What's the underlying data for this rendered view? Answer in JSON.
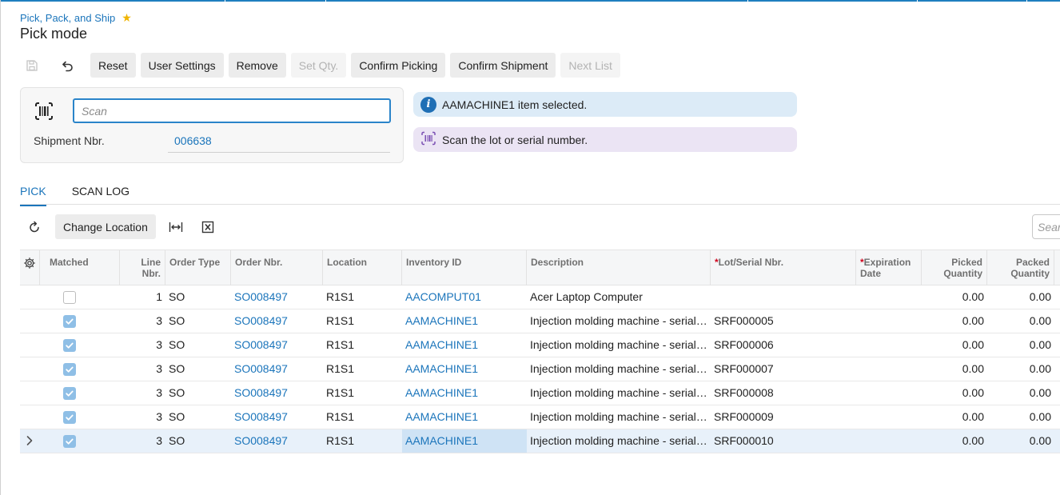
{
  "breadcrumb": "Pick, Pack, and Ship",
  "page_title": "Pick mode",
  "toolbar": {
    "save_icon": "save-icon",
    "undo_icon": "undo-icon",
    "reset": "Reset",
    "user_settings": "User Settings",
    "remove": "Remove",
    "set_qty": "Set Qty.",
    "confirm_picking": "Confirm Picking",
    "confirm_shipment": "Confirm Shipment",
    "next_list": "Next List"
  },
  "scan": {
    "placeholder": "Scan",
    "value": "",
    "shipment_label": "Shipment Nbr.",
    "shipment_value": "006638"
  },
  "messages": {
    "info": "AAMACHINE1 item selected.",
    "prompt": "Scan the lot or serial number."
  },
  "tabs": [
    "PICK",
    "SCAN LOG"
  ],
  "grid_toolbar": {
    "change_location": "Change Location",
    "search_placeholder": "Search"
  },
  "grid": {
    "headers": {
      "matched": "Matched",
      "line_nbr": "Line Nbr.",
      "order_type": "Order Type",
      "order_nbr": "Order Nbr.",
      "location": "Location",
      "inventory_id": "Inventory ID",
      "description": "Description",
      "lot_serial": "Lot/Serial Nbr.",
      "expiration_date": "Expiration Date",
      "picked_quantity": "Picked Quantity",
      "packed_quantity": "Packed Quantity"
    },
    "rows": [
      {
        "matched": false,
        "line_nbr": "1",
        "order_type": "SO",
        "order_nbr": "SO008497",
        "location": "R1S1",
        "inventory_id": "AACOMPUT01",
        "description": "Acer Laptop Computer",
        "lot_serial": "",
        "expiration_date": "",
        "picked": "0.00",
        "packed": "0.00"
      },
      {
        "matched": true,
        "line_nbr": "3",
        "order_type": "SO",
        "order_nbr": "SO008497",
        "location": "R1S1",
        "inventory_id": "AAMACHINE1",
        "description": "Injection molding machine - serial…",
        "lot_serial": "SRF000005",
        "expiration_date": "",
        "picked": "0.00",
        "packed": "0.00"
      },
      {
        "matched": true,
        "line_nbr": "3",
        "order_type": "SO",
        "order_nbr": "SO008497",
        "location": "R1S1",
        "inventory_id": "AAMACHINE1",
        "description": "Injection molding machine - serial…",
        "lot_serial": "SRF000006",
        "expiration_date": "",
        "picked": "0.00",
        "packed": "0.00"
      },
      {
        "matched": true,
        "line_nbr": "3",
        "order_type": "SO",
        "order_nbr": "SO008497",
        "location": "R1S1",
        "inventory_id": "AAMACHINE1",
        "description": "Injection molding machine - serial…",
        "lot_serial": "SRF000007",
        "expiration_date": "",
        "picked": "0.00",
        "packed": "0.00"
      },
      {
        "matched": true,
        "line_nbr": "3",
        "order_type": "SO",
        "order_nbr": "SO008497",
        "location": "R1S1",
        "inventory_id": "AAMACHINE1",
        "description": "Injection molding machine - serial…",
        "lot_serial": "SRF000008",
        "expiration_date": "",
        "picked": "0.00",
        "packed": "0.00"
      },
      {
        "matched": true,
        "line_nbr": "3",
        "order_type": "SO",
        "order_nbr": "SO008497",
        "location": "R1S1",
        "inventory_id": "AAMACHINE1",
        "description": "Injection molding machine - serial…",
        "lot_serial": "SRF000009",
        "expiration_date": "",
        "picked": "0.00",
        "packed": "0.00"
      },
      {
        "matched": true,
        "line_nbr": "3",
        "order_type": "SO",
        "order_nbr": "SO008497",
        "location": "R1S1",
        "inventory_id": "AAMACHINE1",
        "description": "Injection molding machine - serial…",
        "lot_serial": "SRF000010",
        "expiration_date": "",
        "picked": "0.00",
        "packed": "0.00"
      }
    ]
  },
  "colors": {
    "accent": "#1b75bb",
    "info_bg": "#dcebf7",
    "prompt_bg": "#ebe4f4",
    "checkbox_checked": "#8fbfe6"
  }
}
